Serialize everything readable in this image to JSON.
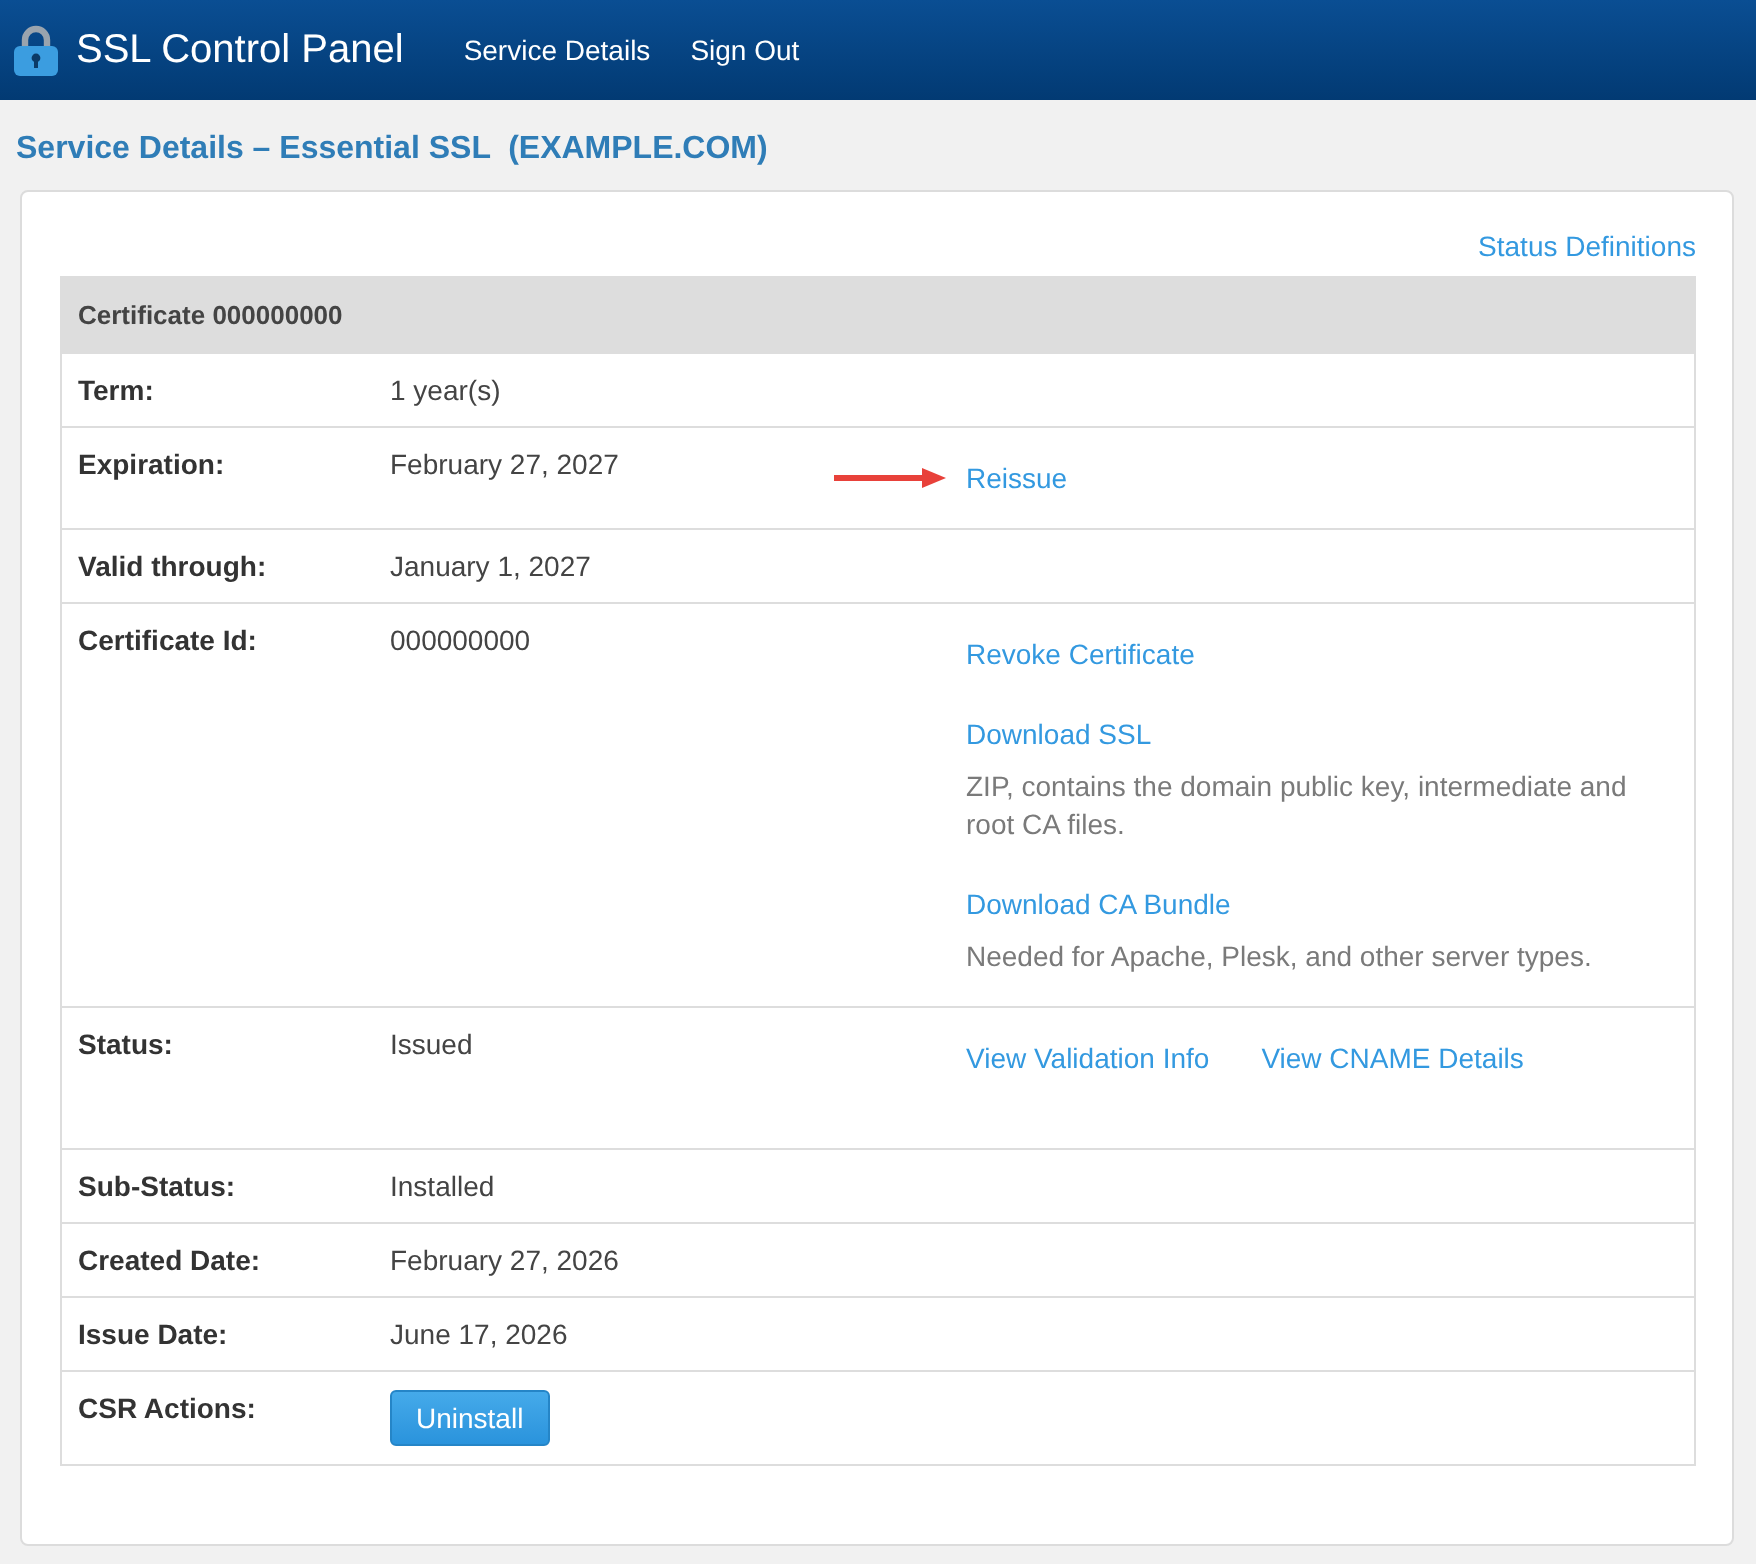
{
  "header": {
    "title": "SSL Control Panel",
    "nav": [
      {
        "label": "Service Details"
      },
      {
        "label": "Sign Out"
      }
    ]
  },
  "page_title": "Service Details – Essential SSL  (EXAMPLE.COM)",
  "panel": {
    "status_definitions": "Status Definitions",
    "table": {
      "heading": "Certificate 000000000",
      "rows": [
        {
          "label": "Term:",
          "value": "1 year(s)"
        },
        {
          "label": "Expiration:",
          "value": "February 27, 2027",
          "actions": [
            {
              "kind": "link",
              "text": "Reissue",
              "pointer_arrow": true
            }
          ]
        },
        {
          "label": "Valid through:",
          "value": "January 1, 2027"
        },
        {
          "label": "Certificate Id:",
          "value": "000000000",
          "actions": [
            {
              "kind": "link",
              "text": "Revoke Certificate",
              "pointer_arrow": false
            },
            {
              "kind": "link",
              "text": "Download SSL",
              "note": "ZIP, contains the domain public key, intermediate and root CA files.",
              "pointer_arrow": false
            },
            {
              "kind": "link",
              "text": "Download CA Bundle",
              "note": "Needed for Apache, Plesk, and other server types.",
              "pointer_arrow": false
            }
          ]
        },
        {
          "label": "Status:",
          "value": "Issued",
          "actions": [
            {
              "kind": "link_row",
              "links": [
                "View Validation Info",
                "View CNAME Details"
              ]
            }
          ]
        },
        {
          "label": "Sub-Status:",
          "value": "Installed"
        },
        {
          "label": "Created Date:",
          "value": "February 27, 2026"
        },
        {
          "label": "Issue Date:",
          "value": "June 17, 2026"
        },
        {
          "label": "CSR Actions:",
          "button": "Uninstall"
        }
      ]
    }
  }
}
